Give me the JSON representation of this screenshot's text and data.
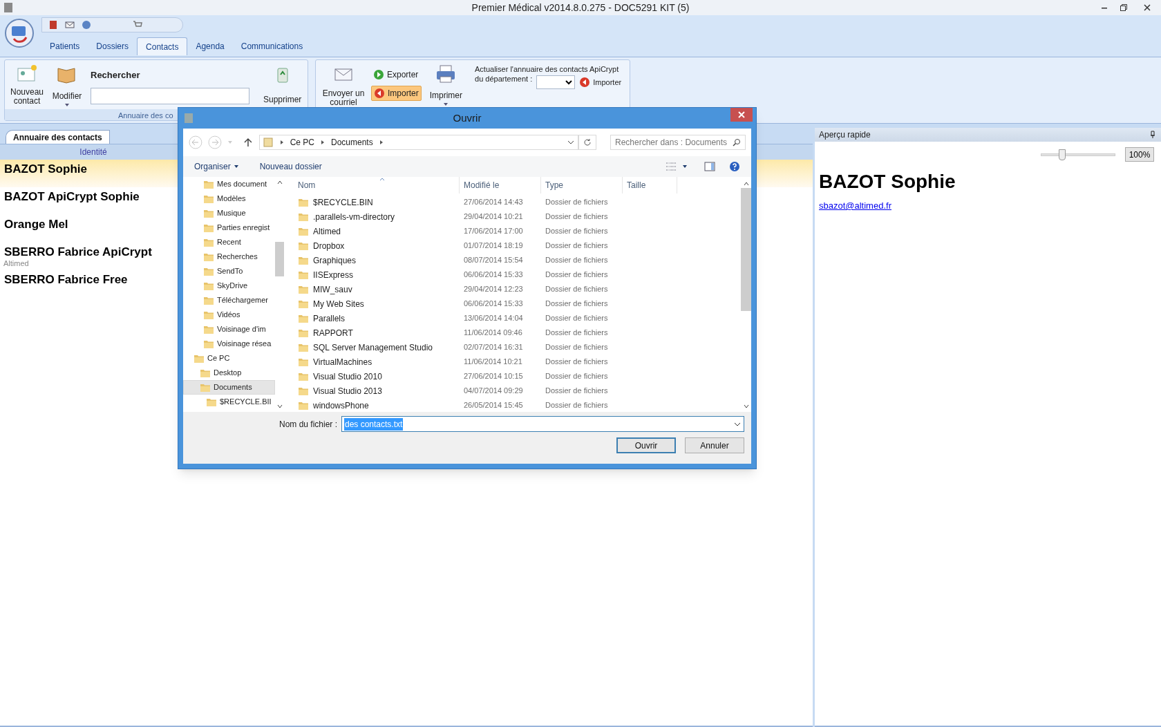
{
  "window": {
    "title": "Premier Médical v2014.8.0.275 - DOC5291 KIT (5)"
  },
  "ribbon_tabs": [
    {
      "label": "Patients",
      "selected": false
    },
    {
      "label": "Dossiers",
      "selected": false
    },
    {
      "label": "Contacts",
      "selected": true
    },
    {
      "label": "Agenda",
      "selected": false
    },
    {
      "label": "Communications",
      "selected": false
    }
  ],
  "ribbon": {
    "new_contact": "Nouveau contact",
    "edit": "Modifier",
    "search_label": "Rechercher",
    "delete": "Supprimer",
    "group_label": "Annuaire des co",
    "send_mail": "Envoyer un courriel",
    "export": "Exporter",
    "import": {
      "label": "Importer",
      "highlighted": true
    },
    "print": "Imprimer",
    "apicrypt_line1": "Actualiser l'annuaire des contacts ApiCrypt",
    "apicrypt_line2": "du département :",
    "apicrypt_import": "Importer"
  },
  "contacts_panel": {
    "tabs": [
      {
        "label": "Annuaire des contacts",
        "selected": true
      }
    ],
    "column": "Identité",
    "rows": [
      {
        "name": "BAZOT Sophie",
        "selected": true
      },
      {
        "name": "BAZOT ApiCrypt Sophie",
        "selected": false
      },
      {
        "name": "Orange Mel",
        "selected": false
      },
      {
        "name": "SBERRO Fabrice ApiCrypt",
        "subtitle": "Altimed",
        "selected": false
      },
      {
        "name": "SBERRO Fabrice Free",
        "selected": false
      }
    ]
  },
  "preview": {
    "title": "Aperçu rapide",
    "zoom": {
      "level": 0.28,
      "reading": "100%"
    },
    "name": "BAZOT Sophie",
    "email": "sbazot@altimed.fr"
  },
  "dialog": {
    "title": "Ouvrir",
    "path": [
      "Ce PC",
      "Documents"
    ],
    "search_placeholder": "Rechercher dans : Documents",
    "organize": "Organiser",
    "new_folder": "Nouveau dossier",
    "nav_items": [
      {
        "label": "Mes document",
        "selected": false
      },
      {
        "label": "Modèles",
        "selected": false
      },
      {
        "label": "Musique",
        "selected": false
      },
      {
        "label": "Parties enregist",
        "selected": false
      },
      {
        "label": "Recent",
        "selected": false
      },
      {
        "label": "Recherches",
        "selected": false
      },
      {
        "label": "SendTo",
        "selected": false
      },
      {
        "label": "SkyDrive",
        "selected": false
      },
      {
        "label": "Téléchargemer",
        "selected": false
      },
      {
        "label": "Vidéos",
        "selected": false
      },
      {
        "label": "Voisinage d'im",
        "selected": false
      },
      {
        "label": "Voisinage résea",
        "selected": false
      }
    ],
    "nav_root": {
      "label": "Ce PC",
      "selected": false,
      "children": [
        {
          "label": "Desktop",
          "selected": false
        },
        {
          "label": "Documents",
          "selected": true,
          "children": [
            {
              "label": "$RECYCLE.BII",
              "selected": false
            }
          ]
        }
      ]
    },
    "columns": [
      "Nom",
      "Modifié le",
      "Type",
      "Taille"
    ],
    "files": [
      {
        "name": "$RECYCLE.BIN",
        "modified": "27/06/2014 14:43",
        "type": "Dossier de fichiers"
      },
      {
        "name": ".parallels-vm-directory",
        "modified": "29/04/2014 10:21",
        "type": "Dossier de fichiers"
      },
      {
        "name": "Altimed",
        "modified": "17/06/2014 17:00",
        "type": "Dossier de fichiers"
      },
      {
        "name": "Dropbox",
        "modified": "01/07/2014 18:19",
        "type": "Dossier de fichiers"
      },
      {
        "name": "Graphiques",
        "modified": "08/07/2014 15:54",
        "type": "Dossier de fichiers"
      },
      {
        "name": "IISExpress",
        "modified": "06/06/2014 15:33",
        "type": "Dossier de fichiers"
      },
      {
        "name": "MIW_sauv",
        "modified": "29/04/2014 12:23",
        "type": "Dossier de fichiers"
      },
      {
        "name": "My Web Sites",
        "modified": "06/06/2014 15:33",
        "type": "Dossier de fichiers"
      },
      {
        "name": "Parallels",
        "modified": "13/06/2014 14:04",
        "type": "Dossier de fichiers"
      },
      {
        "name": "RAPPORT",
        "modified": "11/06/2014 09:46",
        "type": "Dossier de fichiers"
      },
      {
        "name": "SQL Server Management Studio",
        "modified": "02/07/2014 16:31",
        "type": "Dossier de fichiers"
      },
      {
        "name": "VirtualMachines",
        "modified": "11/06/2014 10:21",
        "type": "Dossier de fichiers"
      },
      {
        "name": "Visual Studio 2010",
        "modified": "27/06/2014 10:15",
        "type": "Dossier de fichiers"
      },
      {
        "name": "Visual Studio 2013",
        "modified": "04/07/2014 09:29",
        "type": "Dossier de fichiers"
      },
      {
        "name": "windowsPhone",
        "modified": "26/05/2014 15:45",
        "type": "Dossier de fichiers"
      }
    ],
    "filename_label": "Nom du fichier :",
    "filename": "des contacts.txt",
    "buttons": [
      {
        "label": "Ouvrir",
        "kind": "default"
      },
      {
        "label": "Annuler",
        "kind": "normal"
      }
    ]
  }
}
